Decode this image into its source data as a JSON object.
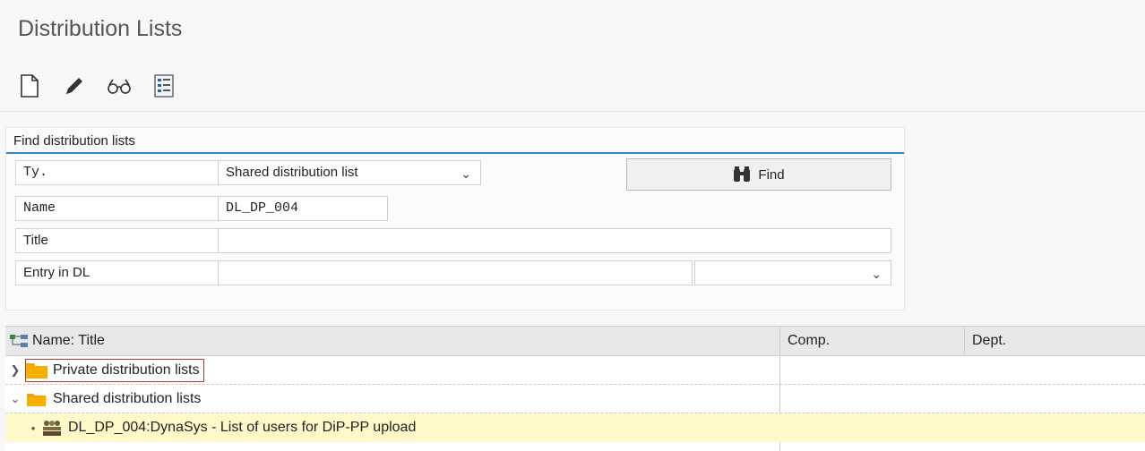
{
  "app": {
    "title": "Distribution Lists"
  },
  "toolbar": {
    "buttons": [
      {
        "name": "new-document-icon"
      },
      {
        "name": "edit-pencil-icon"
      },
      {
        "name": "display-glasses-icon"
      },
      {
        "name": "list-overview-icon"
      }
    ]
  },
  "find": {
    "header": "Find distribution lists",
    "type_label": "Ty.",
    "type_value": "Shared distribution list",
    "name_label": "Name",
    "name_value": "DL_DP_004",
    "title_label": "Title",
    "title_value": "",
    "entry_label": "Entry in DL",
    "entry_value": "",
    "entry_type_value": "",
    "find_button": "Find"
  },
  "tree": {
    "columns": [
      "Name: Title",
      "Comp.",
      "Dept."
    ],
    "rows": [
      {
        "label": "Private distribution lists",
        "expanded": false
      },
      {
        "label": "Shared distribution lists",
        "expanded": true
      },
      {
        "label": "DL_DP_004:DynaSys - List of users for DiP-PP upload",
        "selected": true
      }
    ]
  },
  "colors": {
    "accent": "#2c86c7",
    "selected_row": "#fff9c9",
    "folder": "#f6b100"
  }
}
